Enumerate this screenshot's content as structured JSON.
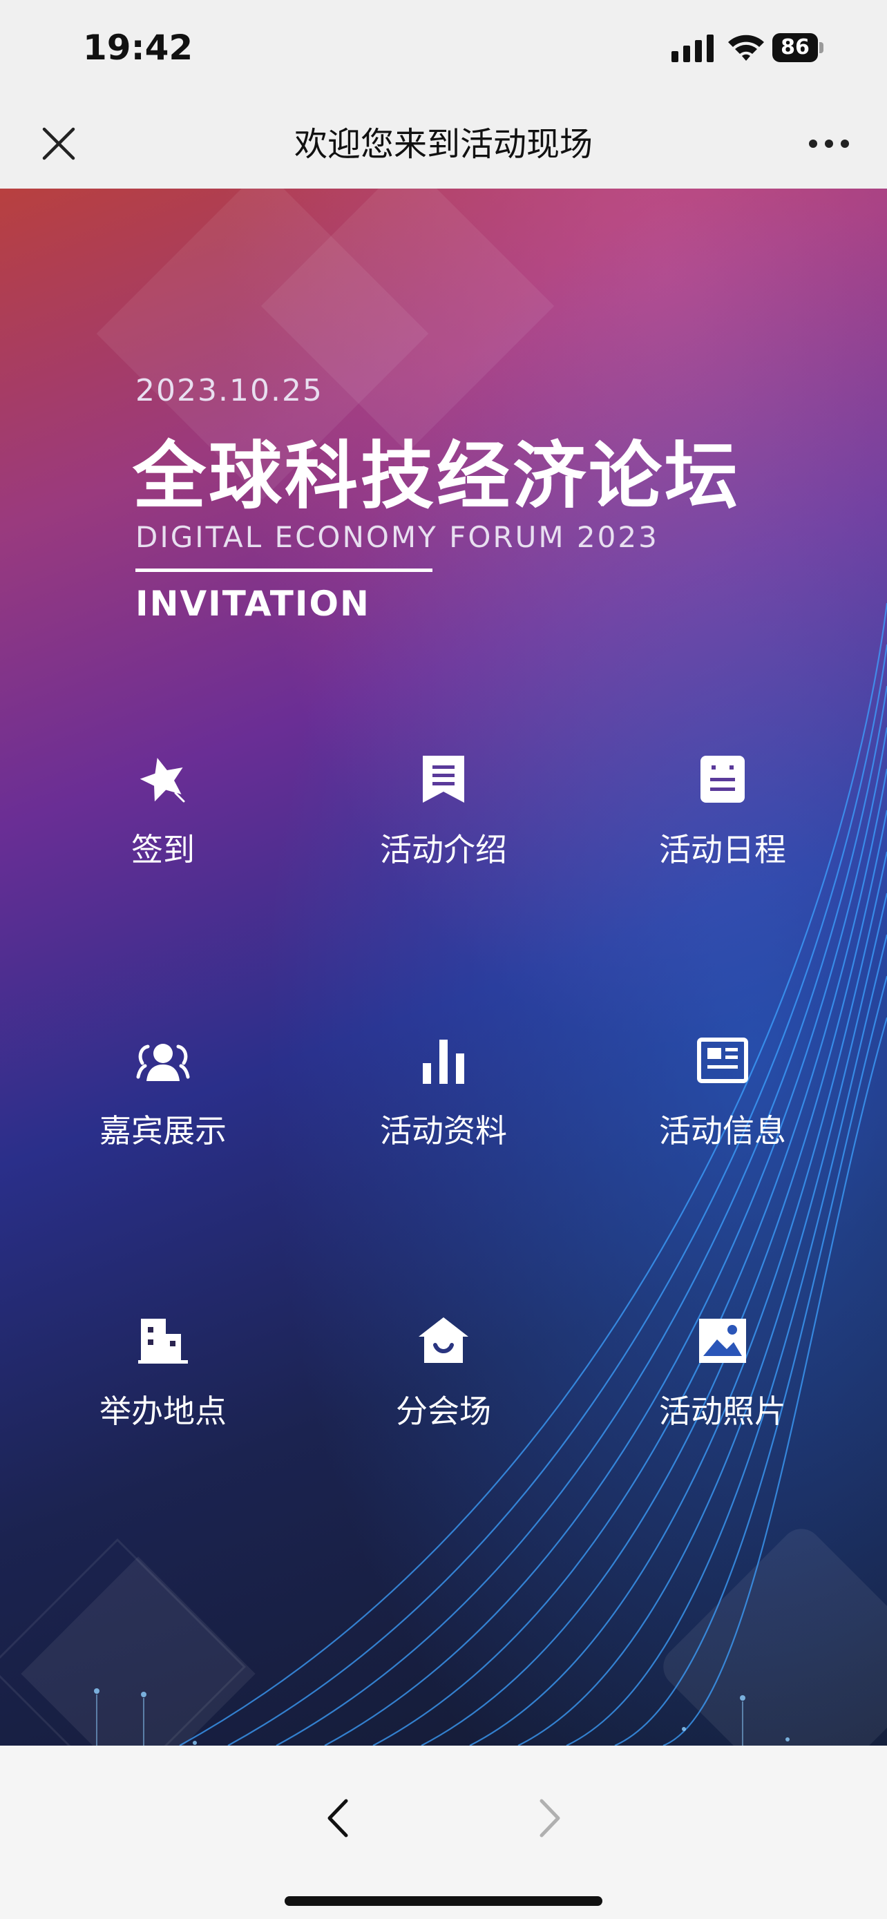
{
  "status_bar": {
    "time": "19:42",
    "battery": "86"
  },
  "nav": {
    "title": "欢迎您来到活动现场"
  },
  "hero": {
    "date": "2023.10.25",
    "title": "全球科技经济论坛",
    "subtitle": "DIGITAL ECONOMY FORUM 2023",
    "invitation": "INVITATION"
  },
  "menu": [
    {
      "label": "签到",
      "icon": "check-in-star-icon"
    },
    {
      "label": "活动介绍",
      "icon": "bookmark-document-icon"
    },
    {
      "label": "活动日程",
      "icon": "schedule-note-icon"
    },
    {
      "label": "嘉宾展示",
      "icon": "guests-icon"
    },
    {
      "label": "活动资料",
      "icon": "bar-chart-icon"
    },
    {
      "label": "活动信息",
      "icon": "news-card-icon"
    },
    {
      "label": "举办地点",
      "icon": "building-icon"
    },
    {
      "label": "分会场",
      "icon": "home-smile-icon"
    },
    {
      "label": "活动照片",
      "icon": "image-icon"
    }
  ],
  "colors": {
    "hero_gradient_top": "#b8403f",
    "hero_gradient_mid": "#6a2e95",
    "hero_gradient_bottom": "#131a30",
    "line_accent": "#39a0ff"
  }
}
